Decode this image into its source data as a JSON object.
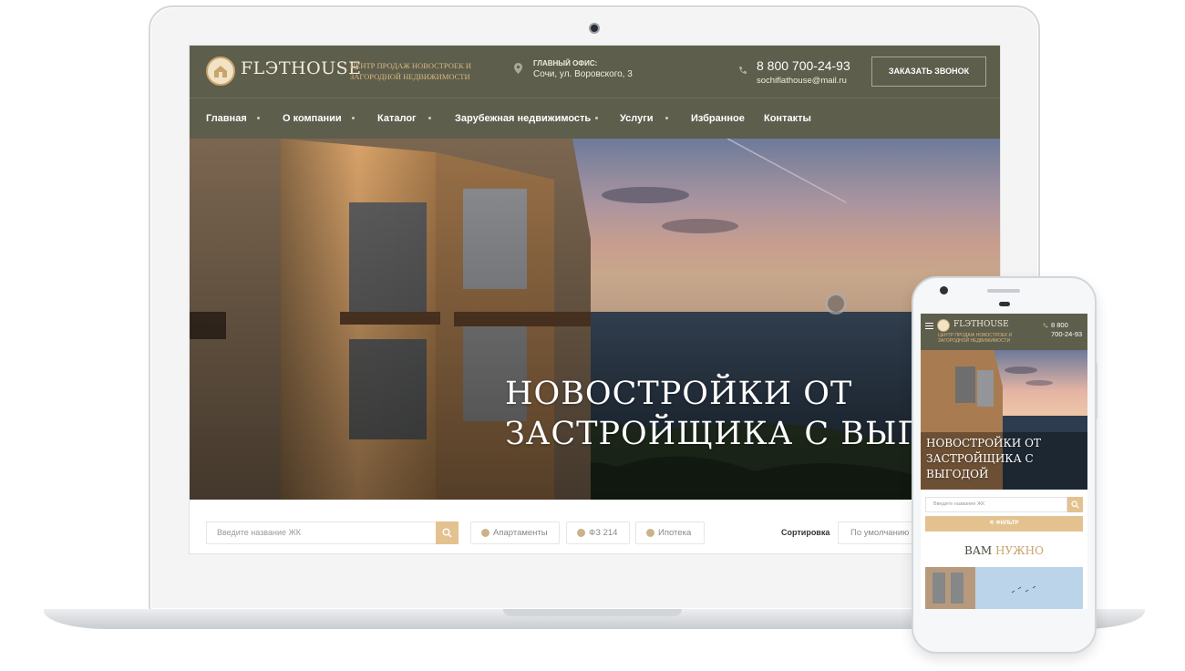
{
  "brand": {
    "name": "FLЭTHOUSE",
    "tagline": "Центр продаж новостроек и загородной недвижимости"
  },
  "header": {
    "office_label": "ГЛАВНЫЙ ОФИС:",
    "office_address": "Сочи, ул. Воровского, 3",
    "phone": "8 800 700-24-93",
    "email": "sochiflathouse@mail.ru",
    "callback_label": "ЗАКАЗАТЬ ЗВОНОК"
  },
  "nav": {
    "items": [
      {
        "label": "Главная",
        "has_submenu": true
      },
      {
        "label": "О компании",
        "has_submenu": true
      },
      {
        "label": "Каталог",
        "has_submenu": true
      },
      {
        "label": "Зарубежная недвижимость",
        "has_submenu": true
      },
      {
        "label": "Услуги",
        "has_submenu": true
      },
      {
        "label": "Избранное",
        "has_submenu": false
      },
      {
        "label": "Контакты",
        "has_submenu": false
      }
    ]
  },
  "hero": {
    "title_line1": "НОВОСТРОЙКИ ОТ",
    "title_line2": "ЗАСТРОЙЩИКА С ВЫГОДОЙ"
  },
  "filters": {
    "search_placeholder": "Введите название ЖК",
    "chips": [
      "Апартаменты",
      "ФЗ 214",
      "Ипотека"
    ],
    "sort_label": "Сортировка",
    "sort_value": "По умолчанию"
  },
  "mobile": {
    "brand_name": "FLЭTHOUSE",
    "tagline": "Центр продаж новостроек и загородной недвижимости",
    "phone_line1": "8 800",
    "phone_line2": "700-24-93",
    "hero_title": "НОВОСТРОЙКИ ОТ ЗАСТРОЙЩИКА С ВЫГОДОЙ",
    "search_placeholder": "Введите название ЖК",
    "filter_label": "ФИЛЬТР",
    "section_title_a": "ВАМ",
    "section_title_b": "НУЖНО"
  },
  "colors": {
    "header_bg": "#5d5e4c",
    "accent_gold": "#e3c290",
    "tagline_gold": "#d9b77f"
  }
}
